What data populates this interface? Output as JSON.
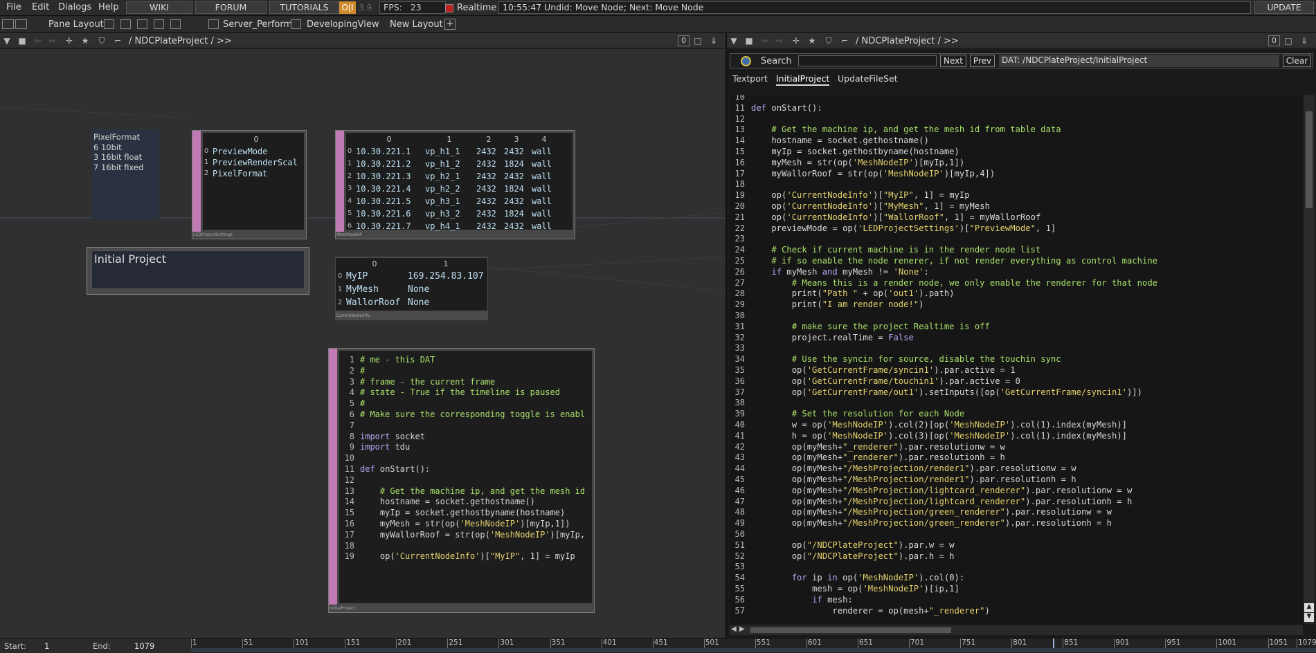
{
  "menubar": {
    "items": [
      "File",
      "Edit",
      "Dialogs",
      "Help"
    ],
    "buttons": [
      "WIKI",
      "FORUM",
      "TUTORIALS"
    ],
    "oii_label": "O|I",
    "fps_faded": "3.9",
    "fps_label": "FPS:",
    "fps_value": "23",
    "realtime_label": "Realtime",
    "undo_text": "10:55:47 Undid: Move Node; Next: Move Node",
    "update_button": "UPDATE"
  },
  "layoutbar": {
    "pane_layout_label": "Pane Layout",
    "layouts": [
      "Server_Perform",
      "DevelopingView"
    ],
    "new_layout_label": "New Layout",
    "add_label": "+"
  },
  "left_pane": {
    "path": "/ NDCPlateProject / >>",
    "counter": "0"
  },
  "right_pane": {
    "path": "/ NDCPlateProject / >>",
    "counter": "0"
  },
  "network": {
    "pixelformat_lines": [
      "PixelFormat",
      "6 10bit",
      "3 16bit float",
      "7 16bit fixed"
    ],
    "settings_table": {
      "header": [
        "0"
      ],
      "rows": [
        [
          "PreviewMode"
        ],
        [
          "PreviewRenderScal"
        ],
        [
          "PixelFormat"
        ]
      ],
      "footer": "LEDProjectSettings"
    },
    "meshnode_table": {
      "header": [
        "0",
        "1",
        "2",
        "3",
        "4"
      ],
      "rows": [
        [
          "10.30.221.1",
          "vp_h1_1",
          "2432",
          "2432",
          "wall"
        ],
        [
          "10.30.221.2",
          "vp_h1_2",
          "2432",
          "1824",
          "wall"
        ],
        [
          "10.30.221.3",
          "vp_h2_1",
          "2432",
          "2432",
          "wall"
        ],
        [
          "10.30.221.4",
          "vp_h2_2",
          "2432",
          "1824",
          "wall"
        ],
        [
          "10.30.221.5",
          "vp_h3_1",
          "2432",
          "2432",
          "wall"
        ],
        [
          "10.30.221.6",
          "vp_h3_2",
          "2432",
          "1824",
          "wall"
        ],
        [
          "10.30.221.7",
          "vp_h4_1",
          "2432",
          "2432",
          "wall"
        ]
      ],
      "footer": "MeshNodeIP"
    },
    "initial_project_title": "Initial Project",
    "current_node_table": {
      "header": [
        "0",
        "1"
      ],
      "rows": [
        [
          "MyIP",
          "169.254.83.107"
        ],
        [
          "MyMesh",
          "None"
        ],
        [
          "WallorRoof",
          "None"
        ]
      ],
      "footer": "CurrentNodeInfo"
    },
    "script_dat": {
      "footer": "InitialProject",
      "lines": [
        {
          "n": "1",
          "t": "# me - this DAT",
          "c": "cm"
        },
        {
          "n": "2",
          "t": "#",
          "c": "cm"
        },
        {
          "n": "3",
          "t": "# frame - the current frame",
          "c": "cm"
        },
        {
          "n": "4",
          "t": "# state - True if the timeline is paused",
          "c": "cm"
        },
        {
          "n": "5",
          "t": "#",
          "c": "cm"
        },
        {
          "n": "6",
          "t": "# Make sure the corresponding toggle is enabl",
          "c": "cm"
        },
        {
          "n": "7",
          "t": "",
          "c": ""
        },
        {
          "n": "8",
          "t": "import socket",
          "c": ""
        },
        {
          "n": "9",
          "t": "import tdu",
          "c": ""
        },
        {
          "n": "10",
          "t": "",
          "c": ""
        },
        {
          "n": "11",
          "t": "def onStart():",
          "c": ""
        },
        {
          "n": "12",
          "t": "",
          "c": ""
        },
        {
          "n": "13",
          "t": "    # Get the machine ip, and get the mesh id",
          "c": "cm"
        },
        {
          "n": "14",
          "t": "    hostname = socket.gethostname()",
          "c": ""
        },
        {
          "n": "15",
          "t": "    myIp = socket.gethostbyname(hostname)",
          "c": ""
        },
        {
          "n": "16",
          "t": "    myMesh = str(op('MeshNodeIP')[myIp,1])",
          "c": ""
        },
        {
          "n": "17",
          "t": "    myWallorRoof = str(op('MeshNodeIP')[myIp,",
          "c": ""
        },
        {
          "n": "18",
          "t": "",
          "c": ""
        },
        {
          "n": "19",
          "t": "    op('CurrentNodeInfo')[\"MyIP\", 1] = myIp",
          "c": ""
        }
      ]
    }
  },
  "textport": {
    "search_label": "Search",
    "next_label": "Next",
    "prev_label": "Prev",
    "dat_path": "DAT:  /NDCPlateProject/InitialProject",
    "clear_label": "Clear",
    "tabs": [
      "Textport",
      "InitialProject",
      "UpdateFileSet"
    ],
    "active_tab": "InitialProject",
    "lines": [
      {
        "n": "10",
        "t": ""
      },
      {
        "n": "11",
        "t": "def onStart():"
      },
      {
        "n": "12",
        "t": ""
      },
      {
        "n": "13",
        "t": "    # Get the machine ip, and get the mesh id from table data"
      },
      {
        "n": "14",
        "t": "    hostname = socket.gethostname()"
      },
      {
        "n": "15",
        "t": "    myIp = socket.gethostbyname(hostname)"
      },
      {
        "n": "16",
        "t": "    myMesh = str(op('MeshNodeIP')[myIp,1])"
      },
      {
        "n": "17",
        "t": "    myWallorRoof = str(op('MeshNodeIP')[myIp,4])"
      },
      {
        "n": "18",
        "t": ""
      },
      {
        "n": "19",
        "t": "    op('CurrentNodeInfo')[\"MyIP\", 1] = myIp"
      },
      {
        "n": "20",
        "t": "    op('CurrentNodeInfo')[\"MyMesh\", 1] = myMesh"
      },
      {
        "n": "21",
        "t": "    op('CurrentNodeInfo')[\"WallorRoof\", 1] = myWallorRoof"
      },
      {
        "n": "22",
        "t": "    previewMode = op('LEDProjectSettings')[\"PreviewMode\", 1]"
      },
      {
        "n": "23",
        "t": ""
      },
      {
        "n": "24",
        "t": "    # Check if current machine is in the render node list"
      },
      {
        "n": "25",
        "t": "    # if so enable the node renerer, if not render everything as control machine"
      },
      {
        "n": "26",
        "t": "    if myMesh and myMesh != 'None':"
      },
      {
        "n": "27",
        "t": "        # Means this is a render node, we only enable the renderer for that node"
      },
      {
        "n": "28",
        "t": "        print(\"Path \" + op('out1').path)"
      },
      {
        "n": "29",
        "t": "        print(\"I am render node!\")"
      },
      {
        "n": "30",
        "t": ""
      },
      {
        "n": "31",
        "t": "        # make sure the project Realtime is off"
      },
      {
        "n": "32",
        "t": "        project.realTime = False"
      },
      {
        "n": "33",
        "t": ""
      },
      {
        "n": "34",
        "t": "        # Use the syncin for source, disable the touchin sync"
      },
      {
        "n": "35",
        "t": "        op('GetCurrentFrame/syncin1').par.active = 1"
      },
      {
        "n": "36",
        "t": "        op('GetCurrentFrame/touchin1').par.active = 0"
      },
      {
        "n": "37",
        "t": "        op('GetCurrentFrame/out1').setInputs([op('GetCurrentFrame/syncin1')])"
      },
      {
        "n": "38",
        "t": ""
      },
      {
        "n": "39",
        "t": "        # Set the resolution for each Node"
      },
      {
        "n": "40",
        "t": "        w = op('MeshNodeIP').col(2)[op('MeshNodeIP').col(1).index(myMesh)]"
      },
      {
        "n": "41",
        "t": "        h = op('MeshNodeIP').col(3)[op('MeshNodeIP').col(1).index(myMesh)]"
      },
      {
        "n": "42",
        "t": "        op(myMesh+\"_renderer\").par.resolutionw = w"
      },
      {
        "n": "43",
        "t": "        op(myMesh+\"_renderer\").par.resolutionh = h"
      },
      {
        "n": "44",
        "t": "        op(myMesh+\"/MeshProjection/render1\").par.resolutionw = w"
      },
      {
        "n": "45",
        "t": "        op(myMesh+\"/MeshProjection/render1\").par.resolutionh = h"
      },
      {
        "n": "46",
        "t": "        op(myMesh+\"/MeshProjection/lightcard_renderer\").par.resolutionw = w"
      },
      {
        "n": "47",
        "t": "        op(myMesh+\"/MeshProjection/lightcard_renderer\").par.resolutionh = h"
      },
      {
        "n": "48",
        "t": "        op(myMesh+\"/MeshProjection/green_renderer\").par.resolutionw = w"
      },
      {
        "n": "49",
        "t": "        op(myMesh+\"/MeshProjection/green_renderer\").par.resolutionh = h"
      },
      {
        "n": "50",
        "t": ""
      },
      {
        "n": "51",
        "t": "        op(\"/NDCPlateProject\").par.w = w"
      },
      {
        "n": "52",
        "t": "        op(\"/NDCPlateProject\").par.h = h"
      },
      {
        "n": "53",
        "t": ""
      },
      {
        "n": "54",
        "t": "        for ip in op('MeshNodeIP').col(0):"
      },
      {
        "n": "55",
        "t": "            mesh = op('MeshNodeIP')[ip,1]"
      },
      {
        "n": "56",
        "t": "            if mesh:"
      },
      {
        "n": "57",
        "t": "                renderer = op(mesh+\"_renderer\")"
      }
    ]
  },
  "timeline": {
    "start_label": "Start:",
    "start_value": "1",
    "end_label": "End:",
    "end_value": "1079",
    "ticks": [
      "1",
      "51",
      "101",
      "151",
      "201",
      "251",
      "301",
      "351",
      "401",
      "451",
      "501",
      "551",
      "601",
      "651",
      "701",
      "751",
      "801",
      "851",
      "901",
      "951",
      "1001",
      "1051",
      "1079"
    ]
  },
  "colors": {
    "accent_pink": "#c07ab4",
    "comment_green": "#a8e06a",
    "string_yellow": "#e5d26e",
    "keyword_purple": "#b4a7f5",
    "cell_blue": "#bde0f2"
  }
}
